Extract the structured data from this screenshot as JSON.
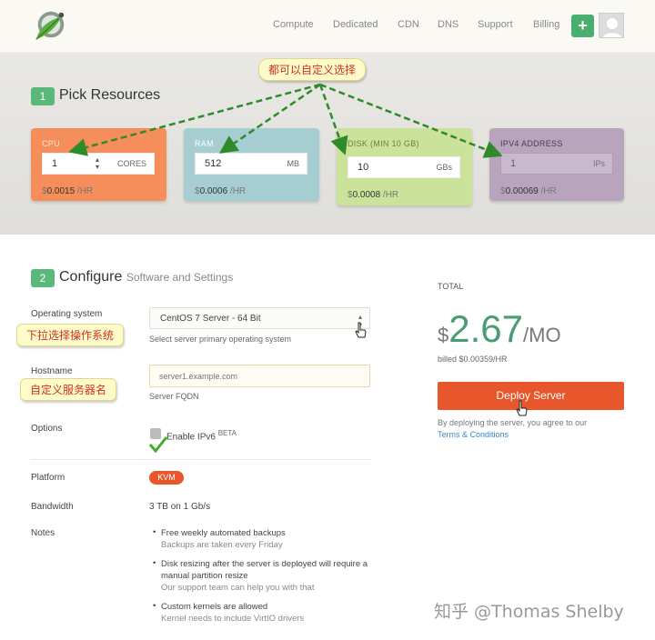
{
  "header": {
    "nav": [
      {
        "label": "Compute"
      },
      {
        "label": "Dedicated"
      },
      {
        "label": "CDN"
      },
      {
        "label": "DNS"
      },
      {
        "label": "Support"
      },
      {
        "label": "Billing"
      }
    ],
    "add_label": "+",
    "logo_icon": "leaf-logo-icon",
    "avatar_icon": "user-avatar-icon"
  },
  "pick": {
    "step": "1",
    "title": "Pick Resources",
    "cards": [
      {
        "label": "CPU",
        "value": "1",
        "unit": "CORES",
        "currency": "$",
        "price": "0.0015",
        "per": " /HR",
        "color": "#f58e5b"
      },
      {
        "label": "RAM",
        "value": "512",
        "unit": "MB",
        "currency": "$",
        "price": "0.0006",
        "per": " /HR",
        "color": "#a6cdd1"
      },
      {
        "label": "DISK (MIN 10 GB)",
        "value": "10",
        "unit": "GBs",
        "currency": "$",
        "price": "0.0008",
        "per": " /HR",
        "color": "#cbe29a"
      },
      {
        "label": "IPV4 ADDRESS",
        "value": "1",
        "unit": "IPs",
        "currency": "$",
        "price": "0.00069",
        "per": " /HR",
        "color": "#b8a4bc"
      }
    ]
  },
  "annotations": {
    "top": "都可以自定义选择",
    "os": "下拉选择操作系统",
    "hostname": "自定义服务器名"
  },
  "configure": {
    "step": "2",
    "title": "Configure",
    "subtitle": "Software and Settings",
    "os_label": "Operating system",
    "os_value": "CentOS 7 Server - 64 Bit",
    "os_hint": "Select server primary operating system",
    "hostname_label": "Hostname",
    "hostname_placeholder": "server1.example.com",
    "hostname_hint": "Server FQDN",
    "options_label": "Options",
    "ipv6_label": "Enable IPv6",
    "ipv6_badge": "BETA",
    "platform_label": "Platform",
    "platform_value": "KVM",
    "bandwidth_label": "Bandwidth",
    "bandwidth_value": "3 TB on 1 Gb/s",
    "notes_label": "Notes",
    "notes": [
      {
        "main": "Free weekly automated backups",
        "sub": "Backups are taken every Friday"
      },
      {
        "main": "Disk resizing after the server is deployed will require a manual partition resize",
        "sub": "Our support team can help you with that"
      },
      {
        "main": "Custom kernels are allowed",
        "sub": "Kernel needs to include VirtIO drivers"
      }
    ]
  },
  "total": {
    "label": "TOTAL",
    "currency": "$",
    "amount": "2.67",
    "period": "/MO",
    "billed": "billed $0.00359/HR",
    "deploy_label": "Deploy Server",
    "terms_text": "By deploying the server, you agree to our",
    "terms_link": "Terms & Conditions"
  },
  "watermark": "知乎 @Thomas Shelby",
  "colors": {
    "accent": "#e8572b",
    "green": "#5cb87a",
    "arrow": "#2f8a2a"
  }
}
